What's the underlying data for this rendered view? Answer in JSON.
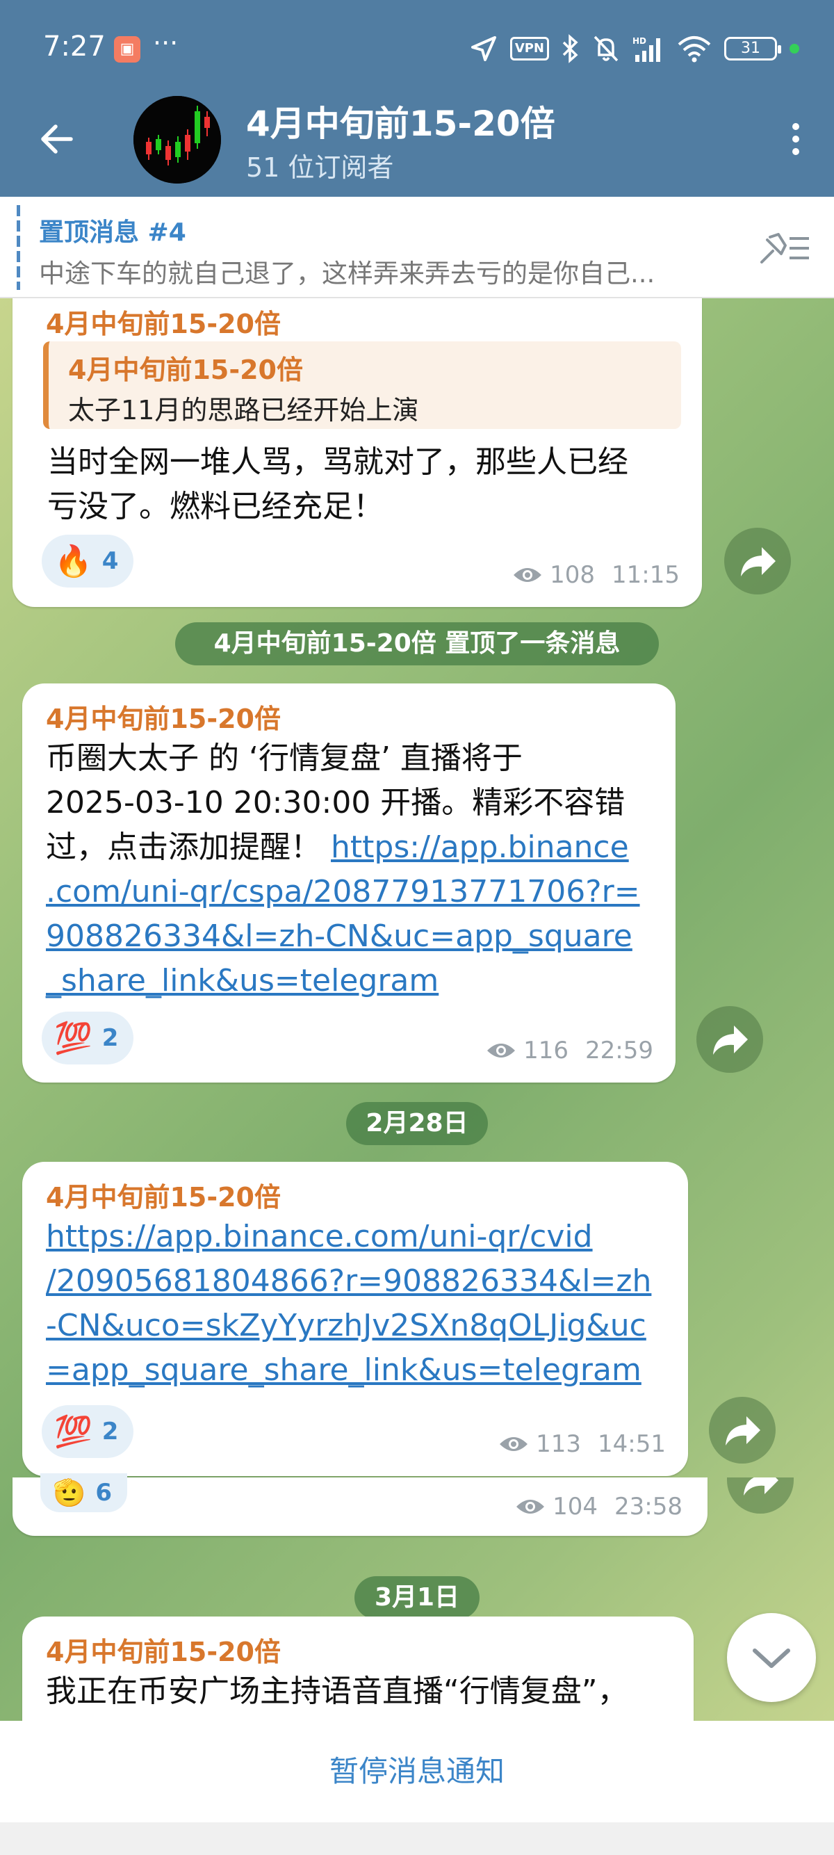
{
  "status_bar": {
    "time": "7:27",
    "more_dots": "···",
    "vpn_label": "VPN",
    "hd_label": "HD",
    "battery": "31"
  },
  "header": {
    "title": "4月中旬前15-20倍",
    "subtitle": "51 位订阅者"
  },
  "pinned": {
    "title": "置顶消息 #4",
    "text": "中途下车的就自己退了，这样弄来弄去亏的是你自己..."
  },
  "messages": [
    {
      "sender": "4月中旬前15-20倍",
      "quote_sender": "4月中旬前15-20倍",
      "quote_text": "太子11月的思路已经开始上演",
      "lines": [
        "当时全网一堆人骂，骂就对了，那些人已经",
        "亏没了。燃料已经充足！"
      ],
      "reaction_emoji": "🔥",
      "reaction_count": "4",
      "views": "108",
      "time": "11:15"
    },
    {
      "sender": "4月中旬前15-20倍",
      "text_lines": [
        "币圈大太子 的 ‘行情复盘’ 直播将于",
        "2025-03-10 20:30:00 开播。精彩不容错",
        "过，点击添加提醒！"
      ],
      "link_lines": [
        "https://app.binance",
        ".com/uni-qr/cspa/20877913771706?r=",
        "908826334&l=zh-CN&uc=app_square",
        "_share_link&us=telegram"
      ],
      "reaction_emoji": "💯",
      "reaction_count": "2",
      "views": "116",
      "time": "22:59"
    },
    {
      "sender": "4月中旬前15-20倍",
      "link_lines": [
        "https://app.binance.com/uni-qr/cvid",
        "/20905681804866?r=908826334&l=zh",
        "-CN&uco=skZyYyrzhJv2SXn8qOLJig&uc",
        "=app_square_share_link&us=telegram"
      ],
      "reaction_emoji": "💯",
      "reaction_count": "2",
      "views": "113",
      "time": "14:51"
    },
    {
      "reaction_emoji": "🫡",
      "reaction_count": "6",
      "views": "104",
      "time": "23:58"
    },
    {
      "sender": "4月中旬前15-20倍",
      "text_lines": [
        "我正在币安广场主持语音直播“行情复盘”，"
      ]
    }
  ],
  "service_pill": "4月中旬前15-20倍 置顶了一条消息",
  "date_pills": [
    "2月28日",
    "3月1日"
  ],
  "bottom": {
    "mute_label": "暂停消息通知"
  },
  "colors": {
    "header_bg": "#517da2",
    "sender": "#d8772c",
    "link": "#2a78c2",
    "accent": "#3b85c8"
  }
}
